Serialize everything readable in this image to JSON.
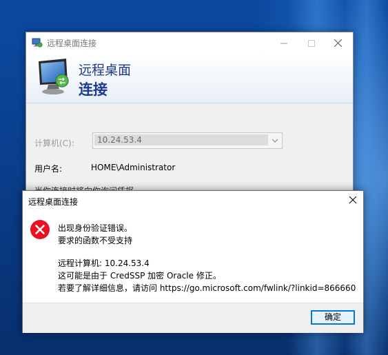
{
  "rdc_window": {
    "title": "远程桌面连接",
    "banner_line1": "远程桌面",
    "banner_line2": "连接",
    "computer_label": "计算机(C):",
    "computer_value": "10.24.53.4",
    "username_label": "用户名:",
    "username_value": "HOME\\Administrator",
    "partial_text": "当你连接时将向你询问凭据。"
  },
  "error_dialog": {
    "title": "远程桌面连接",
    "message_line1": "出现身份验证错误。",
    "message_line2": "要求的函数不受支持",
    "detail_line1": "远程计算机: 10.24.53.4",
    "detail_line2": "这可能是由于 CredSSP 加密 Oracle 修正。",
    "detail_line3": "若要了解详细信息，请访问 https://go.microsoft.com/fwlink/?linkid=866660",
    "ok_label": "确定"
  },
  "icons": {
    "app": "remote-desktop-icon",
    "monitor": "monitor-icon",
    "error": "error-icon",
    "close": "close-icon",
    "minimize": "minimize-icon",
    "maximize": "maximize-icon",
    "dropdown": "chevron-down-icon"
  },
  "colors": {
    "accent": "#0078d7",
    "banner_text": "#1a3a8c",
    "error_red": "#e81123",
    "desktop": "#0a4fa8"
  }
}
